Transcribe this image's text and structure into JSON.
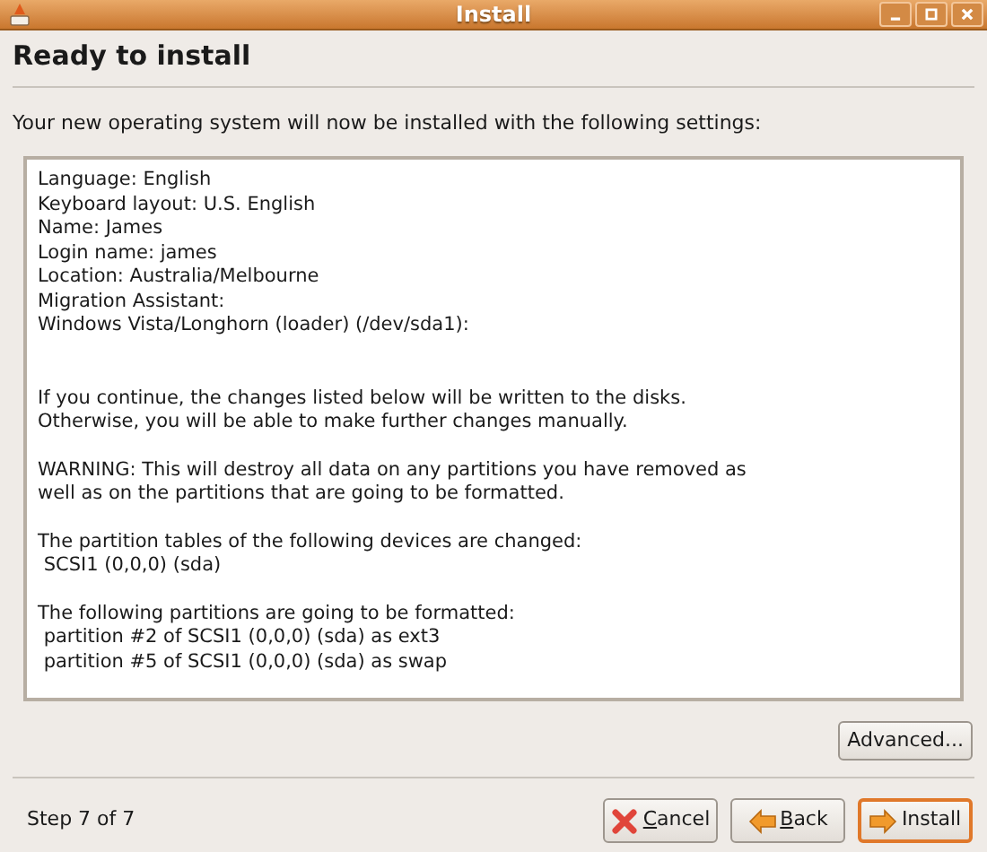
{
  "window": {
    "title": "Install"
  },
  "heading": "Ready to install",
  "intro": "Your new operating system will now be installed with the following settings:",
  "summary": [
    {
      "lines": [
        "Language: English",
        "Keyboard layout: U.S. English",
        "Name: James",
        "Login name: james",
        "Location: Australia/Melbourne",
        "Migration Assistant:",
        "Windows Vista/Longhorn (loader) (/dev/sda1):"
      ]
    },
    {
      "lines": [
        "If you continue, the changes listed below will be written to the disks.",
        "Otherwise, you will be able to make further changes manually."
      ]
    },
    {
      "lines": [
        "WARNING: This will destroy all data on any partitions you have removed as",
        "well as on the partitions that are going to be formatted."
      ]
    },
    {
      "lines": [
        "The partition tables of the following devices are changed:",
        " SCSI1 (0,0,0) (sda)"
      ]
    },
    {
      "lines": [
        "The following partitions are going to be formatted:",
        " partition #2 of SCSI1 (0,0,0) (sda) as ext3",
        " partition #5 of SCSI1 (0,0,0) (sda) as swap"
      ]
    }
  ],
  "advanced_button": "Advanced...",
  "step": "Step 7 of 7",
  "buttons": [
    {
      "kind": "cancel",
      "label": "Cancel",
      "mnemonic": true,
      "default": false
    },
    {
      "kind": "back",
      "label": "Back",
      "mnemonic": true,
      "default": false
    },
    {
      "kind": "forward",
      "label": "Install",
      "mnemonic": false,
      "default": true
    }
  ]
}
